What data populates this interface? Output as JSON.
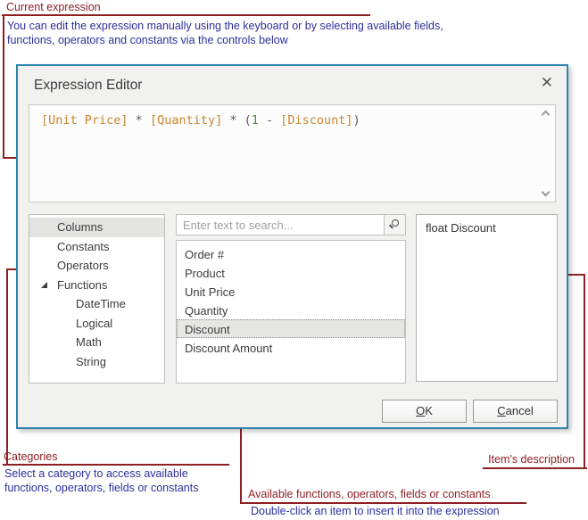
{
  "colors": {
    "dialog_accent_border": "#2f84ab",
    "callout_red": "#8e2023",
    "note_blue": "#2e2e9e",
    "expr_field": "#c9862f",
    "expr_number": "#4a8a3a",
    "expr_operator": "#5a5a5a"
  },
  "annotations": {
    "current_label": "Current expression",
    "top_line1": "You can edit the expression manually using the keyboard or by selecting available fields,",
    "top_line2": "functions, operators and constants via the controls below",
    "categories_label": "Categories",
    "categories_line1": "Select a category to access available",
    "categories_line2": "functions, operators, fields or constants",
    "available_label": "Available functions, operators, fields or constants",
    "available_desc": "Double-click an item to insert it into the expression",
    "items_label": "Item's description"
  },
  "dialog": {
    "title": "Expression Editor",
    "close_icon": "✕",
    "expression": {
      "tokens": [
        {
          "text": "[Unit Price]",
          "type": "field"
        },
        {
          "text": " * ",
          "type": "operator"
        },
        {
          "text": "[Quantity]",
          "type": "field"
        },
        {
          "text": " * ",
          "type": "operator"
        },
        {
          "text": "(",
          "type": "operator"
        },
        {
          "text": "1",
          "type": "number"
        },
        {
          "text": " - ",
          "type": "operator"
        },
        {
          "text": "[Discount]",
          "type": "field"
        },
        {
          "text": ")",
          "type": "operator"
        }
      ]
    },
    "tree": {
      "items": [
        {
          "label": "Columns",
          "level": 0,
          "selected": true
        },
        {
          "label": "Constants",
          "level": 0
        },
        {
          "label": "Operators",
          "level": 0
        },
        {
          "label": "Functions",
          "level": 0,
          "expanded": true
        },
        {
          "label": "DateTime",
          "level": 1
        },
        {
          "label": "Logical",
          "level": 1
        },
        {
          "label": "Math",
          "level": 1
        },
        {
          "label": "String",
          "level": 1
        }
      ]
    },
    "search": {
      "placeholder": "Enter text to search..."
    },
    "list": {
      "items": [
        "Order #",
        "Product",
        "Unit Price",
        "Quantity",
        "Discount",
        "Discount Amount"
      ],
      "selected_index": 4
    },
    "description": {
      "text": "float Discount"
    },
    "buttons": {
      "ok": {
        "mnemonic": "O",
        "rest": "K"
      },
      "cancel": {
        "mnemonic": "C",
        "rest": "ancel"
      }
    }
  }
}
